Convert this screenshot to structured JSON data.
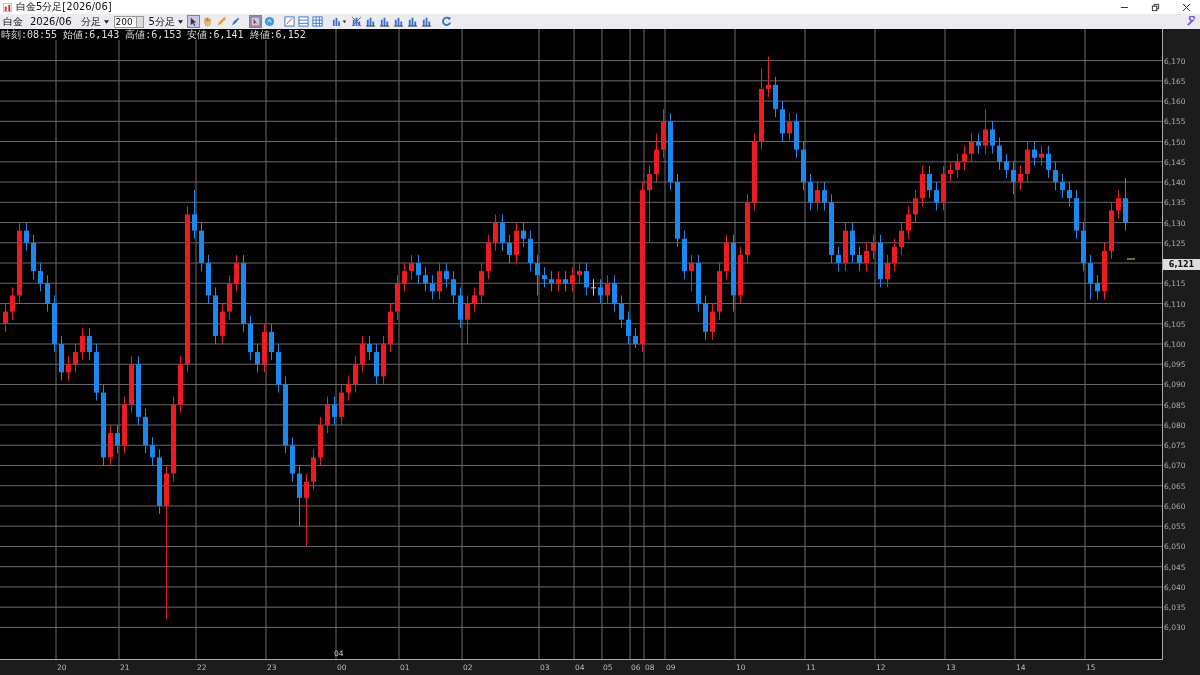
{
  "window": {
    "title": "白金5分足[2026/06]"
  },
  "toolbar": {
    "symbol": "白金",
    "contract": "2026/06",
    "period_unit": "分足",
    "bar_count": "200",
    "period": "5分足"
  },
  "info_line": "時刻:08:55 始値:6,143 高値:6,153 安値:6,141 終値:6,152",
  "current_price": "6,121",
  "month_label": "04",
  "chart_data": {
    "type": "candlestick",
    "categories": [
      null,
      null,
      null,
      null,
      null,
      null,
      null,
      null,
      "20",
      null,
      null,
      null,
      null,
      null,
      null,
      null,
      null,
      "21",
      null,
      null,
      null,
      null,
      null,
      null,
      null,
      null,
      null,
      null,
      "22",
      null,
      null,
      null,
      null,
      null,
      null,
      null,
      null,
      null,
      "23",
      null,
      null,
      null,
      null,
      null,
      null,
      null,
      null,
      null,
      "00",
      null,
      null,
      null,
      null,
      null,
      null,
      null,
      null,
      "01",
      null,
      null,
      null,
      null,
      null,
      null,
      null,
      null,
      "02",
      null,
      null,
      null,
      null,
      null,
      null,
      null,
      null,
      null,
      null,
      "03",
      null,
      null,
      null,
      null,
      "04",
      null,
      null,
      null,
      "05",
      null,
      null,
      null,
      "06",
      null,
      "08",
      null,
      null,
      "09",
      null,
      null,
      null,
      null,
      null,
      null,
      null,
      null,
      null,
      "10",
      null,
      null,
      null,
      null,
      null,
      null,
      null,
      null,
      null,
      "11",
      null,
      null,
      null,
      null,
      null,
      null,
      null,
      null,
      null,
      "12",
      null,
      null,
      null,
      null,
      null,
      null,
      null,
      null,
      null,
      "13",
      null,
      null,
      null,
      null,
      null,
      null,
      null,
      null,
      null,
      "14",
      null,
      null,
      null,
      null,
      null,
      null,
      null,
      null,
      null,
      "15",
      null,
      null,
      null,
      null,
      null
    ],
    "ohlc": [
      [
        6105,
        6110,
        6103,
        6108
      ],
      [
        6108,
        6114,
        6106,
        6112
      ],
      [
        6112,
        6130,
        6110,
        6128
      ],
      [
        6128,
        6130,
        6123,
        6125
      ],
      [
        6125,
        6127,
        6116,
        6118
      ],
      [
        6118,
        6120,
        6113,
        6115
      ],
      [
        6115,
        6117,
        6108,
        6110
      ],
      [
        6110,
        6112,
        6098,
        6100
      ],
      [
        6100,
        6102,
        6091,
        6093
      ],
      [
        6093,
        6097,
        6091,
        6095
      ],
      [
        6095,
        6100,
        6093,
        6098
      ],
      [
        6098,
        6104,
        6096,
        6102
      ],
      [
        6102,
        6104,
        6096,
        6098
      ],
      [
        6098,
        6100,
        6086,
        6088
      ],
      [
        6088,
        6090,
        6070,
        6072
      ],
      [
        6072,
        6080,
        6070,
        6078
      ],
      [
        6078,
        6080,
        6073,
        6075
      ],
      [
        6075,
        6087,
        6073,
        6085
      ],
      [
        6085,
        6097,
        6083,
        6095
      ],
      [
        6095,
        6097,
        6080,
        6082
      ],
      [
        6082,
        6084,
        6073,
        6075
      ],
      [
        6075,
        6077,
        6070,
        6072
      ],
      [
        6072,
        6074,
        6058,
        6060
      ],
      [
        6060,
        6070,
        6032,
        6068
      ],
      [
        6068,
        6087,
        6066,
        6085
      ],
      [
        6085,
        6097,
        6083,
        6095
      ],
      [
        6095,
        6134,
        6093,
        6132
      ],
      [
        6132,
        6138,
        6126,
        6128
      ],
      [
        6128,
        6130,
        6118,
        6120
      ],
      [
        6120,
        6122,
        6110,
        6112
      ],
      [
        6112,
        6114,
        6100,
        6102
      ],
      [
        6102,
        6110,
        6100,
        6108
      ],
      [
        6108,
        6117,
        6106,
        6115
      ],
      [
        6115,
        6122,
        6113,
        6120
      ],
      [
        6120,
        6122,
        6103,
        6105
      ],
      [
        6105,
        6107,
        6096,
        6098
      ],
      [
        6098,
        6100,
        6093,
        6095
      ],
      [
        6095,
        6105,
        6093,
        6103
      ],
      [
        6103,
        6105,
        6096,
        6098
      ],
      [
        6098,
        6100,
        6088,
        6090
      ],
      [
        6090,
        6092,
        6073,
        6075
      ],
      [
        6075,
        6077,
        6066,
        6068
      ],
      [
        6068,
        6070,
        6055,
        6062
      ],
      [
        6062,
        6068,
        6050,
        6066
      ],
      [
        6066,
        6074,
        6064,
        6072
      ],
      [
        6072,
        6082,
        6070,
        6080
      ],
      [
        6080,
        6087,
        6078,
        6085
      ],
      [
        6085,
        6087,
        6080,
        6082
      ],
      [
        6082,
        6090,
        6080,
        6088
      ],
      [
        6088,
        6092,
        6086,
        6090
      ],
      [
        6090,
        6097,
        6088,
        6095
      ],
      [
        6095,
        6102,
        6093,
        6100
      ],
      [
        6100,
        6102,
        6096,
        6098
      ],
      [
        6098,
        6100,
        6090,
        6092
      ],
      [
        6092,
        6102,
        6090,
        6100
      ],
      [
        6100,
        6110,
        6098,
        6108
      ],
      [
        6108,
        6117,
        6106,
        6115
      ],
      [
        6115,
        6120,
        6113,
        6118
      ],
      [
        6118,
        6122,
        6116,
        6120
      ],
      [
        6120,
        6122,
        6115,
        6117
      ],
      [
        6117,
        6119,
        6113,
        6115
      ],
      [
        6115,
        6117,
        6111,
        6113
      ],
      [
        6113,
        6120,
        6111,
        6118
      ],
      [
        6118,
        6120,
        6114,
        6116
      ],
      [
        6116,
        6118,
        6110,
        6112
      ],
      [
        6112,
        6114,
        6104,
        6106
      ],
      [
        6106,
        6112,
        6100,
        6110
      ],
      [
        6110,
        6114,
        6108,
        6112
      ],
      [
        6112,
        6120,
        6110,
        6118
      ],
      [
        6118,
        6127,
        6116,
        6125
      ],
      [
        6125,
        6132,
        6123,
        6130
      ],
      [
        6130,
        6132,
        6123,
        6125
      ],
      [
        6125,
        6127,
        6120,
        6122
      ],
      [
        6122,
        6130,
        6120,
        6128
      ],
      [
        6128,
        6130,
        6124,
        6126
      ],
      [
        6126,
        6128,
        6118,
        6120
      ],
      [
        6120,
        6122,
        6112,
        6117
      ],
      [
        6117,
        6119,
        6114,
        6116
      ],
      [
        6116,
        6118,
        6113,
        6115
      ],
      [
        6115,
        6118,
        6113,
        6116
      ],
      [
        6116,
        6118,
        6113,
        6115
      ],
      [
        6115,
        6119,
        6113,
        6117
      ],
      [
        6117,
        6120,
        6115,
        6118
      ],
      [
        6118,
        6120,
        6112,
        6114
      ],
      [
        6114,
        6116,
        6112,
        6114
      ],
      [
        6114,
        6116,
        6110,
        6112
      ],
      [
        6112,
        6117,
        6110,
        6115
      ],
      [
        6115,
        6117,
        6108,
        6110
      ],
      [
        6110,
        6112,
        6104,
        6106
      ],
      [
        6106,
        6108,
        6100,
        6102
      ],
      [
        6102,
        6104,
        6099,
        6100
      ],
      [
        6100,
        6140,
        6098,
        6138
      ],
      [
        6138,
        6144,
        6125,
        6142
      ],
      [
        6142,
        6152,
        6140,
        6148
      ],
      [
        6148,
        6158,
        6146,
        6155
      ],
      [
        6155,
        6157,
        6138,
        6140
      ],
      [
        6140,
        6142,
        6124,
        6126
      ],
      [
        6126,
        6128,
        6116,
        6118
      ],
      [
        6118,
        6122,
        6113,
        6120
      ],
      [
        6120,
        6122,
        6108,
        6110
      ],
      [
        6110,
        6112,
        6101,
        6103
      ],
      [
        6103,
        6110,
        6101,
        6108
      ],
      [
        6108,
        6120,
        6106,
        6118
      ],
      [
        6118,
        6127,
        6116,
        6125
      ],
      [
        6125,
        6127,
        6108,
        6112
      ],
      [
        6112,
        6124,
        6110,
        6122
      ],
      [
        6122,
        6137,
        6120,
        6135
      ],
      [
        6135,
        6152,
        6133,
        6150
      ],
      [
        6150,
        6168,
        6148,
        6163
      ],
      [
        6163,
        6171,
        6161,
        6164
      ],
      [
        6164,
        6166,
        6156,
        6158
      ],
      [
        6158,
        6160,
        6150,
        6152
      ],
      [
        6152,
        6157,
        6150,
        6155
      ],
      [
        6155,
        6157,
        6146,
        6148
      ],
      [
        6148,
        6150,
        6138,
        6140
      ],
      [
        6140,
        6142,
        6133,
        6135
      ],
      [
        6135,
        6140,
        6133,
        6138
      ],
      [
        6138,
        6140,
        6133,
        6135
      ],
      [
        6135,
        6137,
        6120,
        6122
      ],
      [
        6122,
        6124,
        6118,
        6120
      ],
      [
        6120,
        6130,
        6118,
        6128
      ],
      [
        6128,
        6130,
        6120,
        6122
      ],
      [
        6122,
        6124,
        6118,
        6120
      ],
      [
        6120,
        6125,
        6118,
        6123
      ],
      [
        6123,
        6127,
        6121,
        6125
      ],
      [
        6125,
        6127,
        6114,
        6116
      ],
      [
        6116,
        6122,
        6114,
        6120
      ],
      [
        6120,
        6126,
        6118,
        6124
      ],
      [
        6124,
        6130,
        6122,
        6128
      ],
      [
        6128,
        6134,
        6126,
        6132
      ],
      [
        6132,
        6138,
        6130,
        6136
      ],
      [
        6136,
        6144,
        6134,
        6142
      ],
      [
        6142,
        6144,
        6136,
        6138
      ],
      [
        6138,
        6140,
        6133,
        6135
      ],
      [
        6135,
        6144,
        6133,
        6142
      ],
      [
        6142,
        6145,
        6140,
        6143
      ],
      [
        6143,
        6147,
        6141,
        6145
      ],
      [
        6145,
        6149,
        6143,
        6147
      ],
      [
        6147,
        6152,
        6145,
        6150
      ],
      [
        6150,
        6152,
        6147,
        6149
      ],
      [
        6149,
        6158,
        6147,
        6153
      ],
      [
        6153,
        6155,
        6147,
        6149
      ],
      [
        6149,
        6151,
        6143,
        6145
      ],
      [
        6145,
        6147,
        6141,
        6143
      ],
      [
        6143,
        6145,
        6137,
        6140
      ],
      [
        6140,
        6144,
        6138,
        6142
      ],
      [
        6142,
        6150,
        6140,
        6148
      ],
      [
        6148,
        6150,
        6144,
        6146
      ],
      [
        6146,
        6149,
        6144,
        6147
      ],
      [
        6147,
        6149,
        6141,
        6143
      ],
      [
        6143,
        6145,
        6138,
        6140
      ],
      [
        6140,
        6142,
        6136,
        6138
      ],
      [
        6138,
        6140,
        6134,
        6136
      ],
      [
        6136,
        6138,
        6126,
        6128
      ],
      [
        6128,
        6130,
        6118,
        6120
      ],
      [
        6120,
        6122,
        6111,
        6115
      ],
      [
        6115,
        6117,
        6111,
        6113
      ],
      [
        6113,
        6125,
        6111,
        6123
      ],
      [
        6123,
        6135,
        6121,
        6133
      ],
      [
        6133,
        6138,
        6131,
        6136
      ],
      [
        6136,
        6141,
        6128,
        6130
      ]
    ],
    "ylim": [
      6022.2,
      6177.8
    ],
    "grid": true,
    "yticks": [
      {
        "value": 6170,
        "label": "6,170"
      },
      {
        "value": 6165,
        "label": "6,165"
      },
      {
        "value": 6160,
        "label": "6,160"
      },
      {
        "value": 6155,
        "label": "6,155"
      },
      {
        "value": 6150,
        "label": "6,150"
      },
      {
        "value": 6145,
        "label": "6,145"
      },
      {
        "value": 6140,
        "label": "6,140"
      },
      {
        "value": 6135,
        "label": "6,135"
      },
      {
        "value": 6130,
        "label": "6,130"
      },
      {
        "value": 6125,
        "label": "6,125"
      },
      {
        "value": 6115,
        "label": "6,115"
      },
      {
        "value": 6110,
        "label": "6,110"
      },
      {
        "value": 6105,
        "label": "6,105"
      },
      {
        "value": 6100,
        "label": "6,100"
      },
      {
        "value": 6095,
        "label": "6,095"
      },
      {
        "value": 6090,
        "label": "6,090"
      },
      {
        "value": 6085,
        "label": "6,085"
      },
      {
        "value": 6080,
        "label": "6,080"
      },
      {
        "value": 6075,
        "label": "6,075"
      },
      {
        "value": 6070,
        "label": "6,070"
      },
      {
        "value": 6065,
        "label": "6,065"
      },
      {
        "value": 6060,
        "label": "6,060"
      },
      {
        "value": 6055,
        "label": "6,055"
      },
      {
        "value": 6050,
        "label": "6,050"
      },
      {
        "value": 6045,
        "label": "6,045"
      },
      {
        "value": 6040,
        "label": "6,040"
      },
      {
        "value": 6035,
        "label": "6,035"
      },
      {
        "value": 6030,
        "label": "6,030"
      }
    ]
  }
}
